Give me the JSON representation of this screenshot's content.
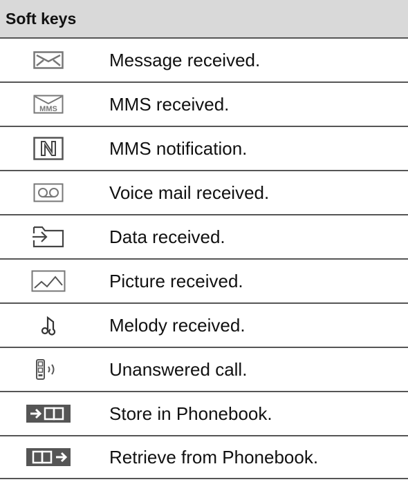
{
  "table": {
    "title": "Soft keys",
    "rows": [
      {
        "icon": "envelope-icon",
        "label": "Message received."
      },
      {
        "icon": "mms-envelope-icon",
        "label": "MMS received."
      },
      {
        "icon": "mms-notification-icon",
        "label": "MMS notification."
      },
      {
        "icon": "voicemail-icon",
        "label": "Voice mail received."
      },
      {
        "icon": "data-received-icon",
        "label": "Data received."
      },
      {
        "icon": "picture-icon",
        "label": "Picture received."
      },
      {
        "icon": "melody-note-icon",
        "label": "Melody received."
      },
      {
        "icon": "unanswered-call-icon",
        "label": "Unanswered call."
      },
      {
        "icon": "store-phonebook-icon",
        "label": "Store in Phonebook."
      },
      {
        "icon": "retrieve-phonebook-icon",
        "label": "Retrieve from Phonebook."
      }
    ]
  }
}
